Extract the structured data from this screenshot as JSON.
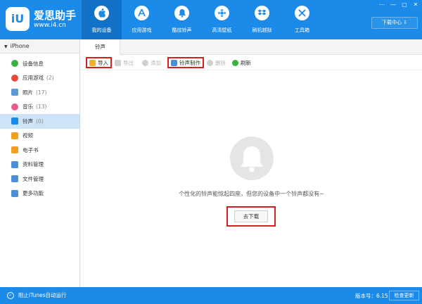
{
  "app": {
    "name": "爱思助手",
    "url": "www.i4.cn",
    "logo_mark": "iU"
  },
  "nav": [
    {
      "label": "我的设备",
      "icon": "apple-icon",
      "active": true
    },
    {
      "label": "应用游戏",
      "icon": "app-store-icon"
    },
    {
      "label": "酷炫铃声",
      "icon": "bell-icon"
    },
    {
      "label": "高清壁纸",
      "icon": "flower-icon"
    },
    {
      "label": "刷机越狱",
      "icon": "dropbox-icon"
    },
    {
      "label": "工具箱",
      "icon": "tools-icon"
    }
  ],
  "window_controls": {
    "menu": "⋯",
    "minimize": "—",
    "maximize": "▢",
    "close": "✕"
  },
  "download_center": "下载中心 ⇩",
  "sidebar": {
    "device": "iPhone",
    "items": [
      {
        "label": "设备信息",
        "count": "",
        "color": "#3cb043"
      },
      {
        "label": "应用游戏",
        "count": "(2)",
        "color": "#e84b3c"
      },
      {
        "label": "照片",
        "count": "(17)",
        "color": "#5b9bd5"
      },
      {
        "label": "音乐",
        "count": "(13)",
        "color": "#e85c8a"
      },
      {
        "label": "铃声",
        "count": "(0)",
        "color": "#1b8ae8",
        "active": true
      },
      {
        "label": "视频",
        "count": "",
        "color": "#f0a020"
      },
      {
        "label": "电子书",
        "count": "",
        "color": "#f0a020"
      },
      {
        "label": "资料管理",
        "count": "",
        "color": "#4a90d9"
      },
      {
        "label": "文件管理",
        "count": "",
        "color": "#4a90d9"
      },
      {
        "label": "更多功能",
        "count": "",
        "color": "#4a90d9"
      }
    ]
  },
  "tab": "铃声",
  "toolbar": {
    "import": "导入",
    "export": "导出",
    "add": "添加",
    "make": "铃声制作",
    "delete": "删除",
    "refresh": "刷新"
  },
  "empty": {
    "message": "个性化的铃声能惊起四座，但您的设备中一个铃声都没有~",
    "button": "去下载"
  },
  "footer": {
    "itunes": "阻止iTunes自动运行",
    "version": "版本号：6.15",
    "update": "检查更新"
  },
  "colors": {
    "brand": "#1b8ae8",
    "nav_active": "#1272c8",
    "highlight": "#d61f1f",
    "side_active": "#cde3f8"
  }
}
